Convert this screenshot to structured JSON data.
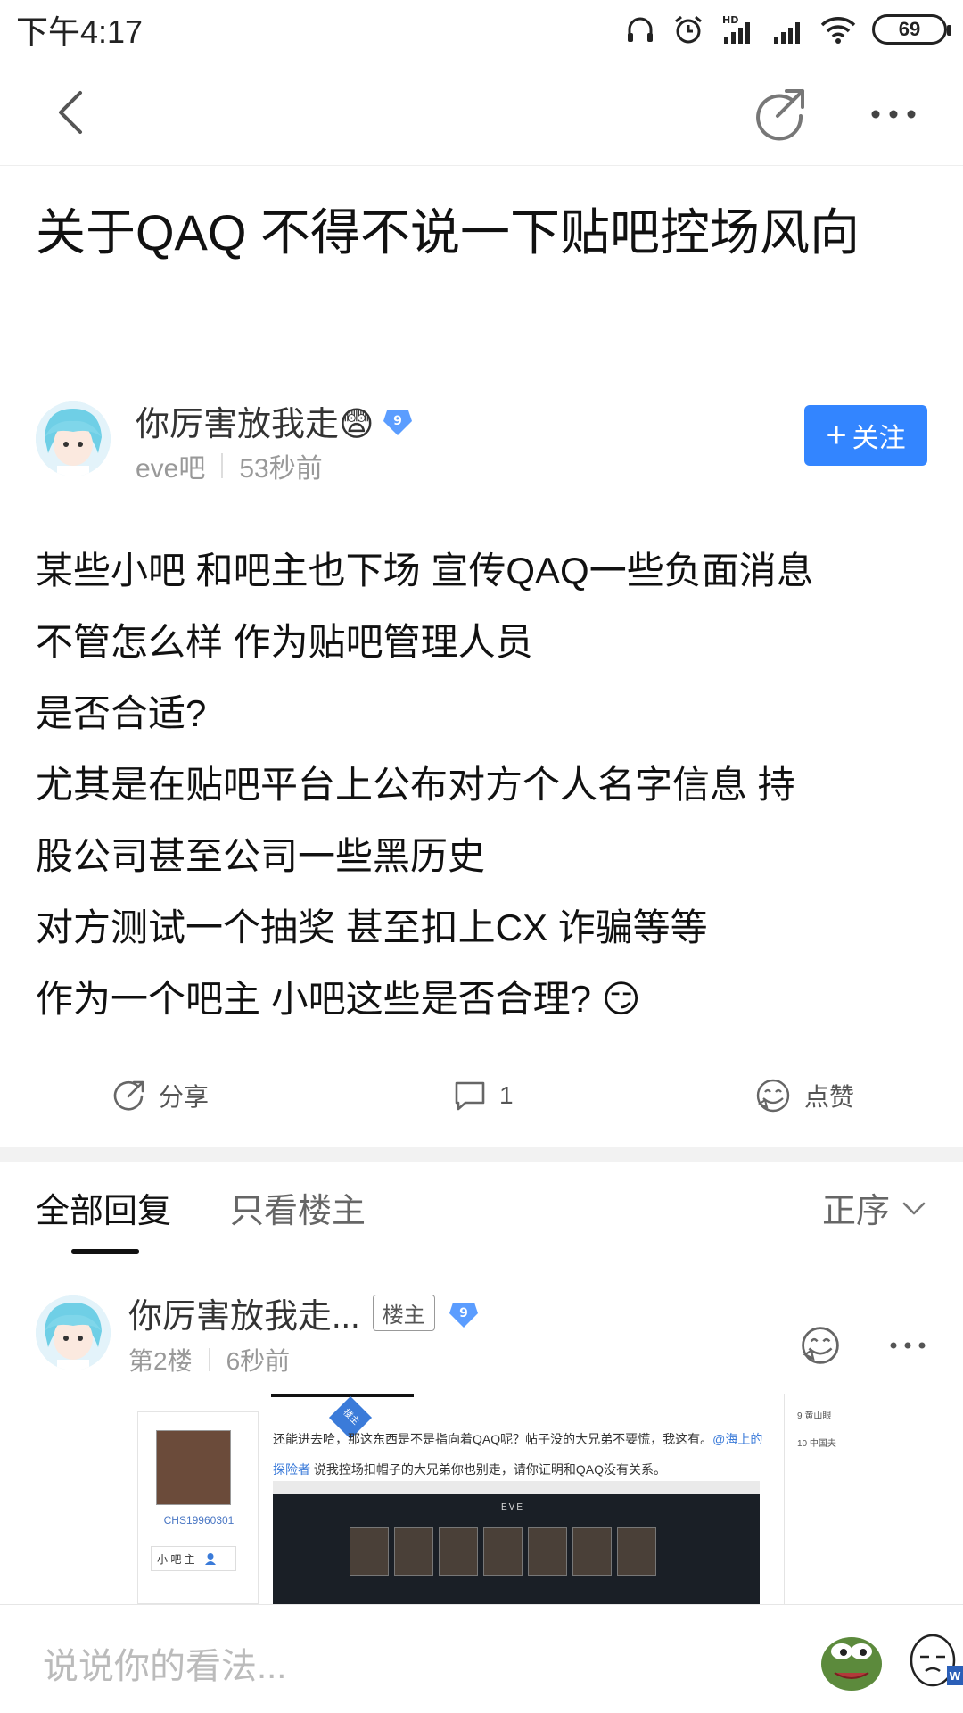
{
  "status_bar": {
    "time": "下午4:17",
    "battery": "69",
    "icons": [
      "headphones-icon",
      "alarm-icon",
      "hd-signal-icon",
      "signal-icon",
      "wifi-icon",
      "battery-icon"
    ]
  },
  "nav": {
    "back_icon": "chevron-left-icon",
    "share_icon": "share-icon",
    "more_icon": "more-icon"
  },
  "post": {
    "title": "关于QAQ 不得不说一下贴吧控场风向",
    "author": {
      "name": "你厉害放我走😨",
      "level": "9",
      "forum": "eve吧",
      "time": "53秒前"
    },
    "follow_label": "关注",
    "body_lines": [
      "某些小吧 和吧主也下场 宣传QAQ一些负面消息",
      "不管怎么样 作为贴吧管理人员",
      "是否合适?",
      "尤其是在贴吧平台上公布对方个人名字信息 持",
      "股公司甚至公司一些黑历史",
      "对方测试一个抽奖 甚至扣上CX 诈骗等等",
      "作为一个吧主 小吧这些是否合理? 😏"
    ],
    "actions": {
      "share_label": "分享",
      "comment_count": "1",
      "like_label": "点赞"
    }
  },
  "tabs": {
    "all_replies": "全部回复",
    "owner_only": "只看楼主",
    "sort_label": "正序"
  },
  "reply": {
    "name": "你厉害放我走...",
    "owner_tag": "楼主",
    "level": "9",
    "floor": "第2楼",
    "time": "6秒前",
    "image": {
      "ribbon": "楼主",
      "user_id": "CHS19960301",
      "role": "小 吧 主",
      "text_1": "还能进去哈，那这东西是不是指向着QAQ呢？帖子没的大兄弟不要慌，我这有。",
      "mention": "@海上的探险者",
      "text_2": "说我控场扣帽子的大兄弟你也别走，请你证明和QAQ没有关系。",
      "game_logo": "EVE",
      "side_1": "9   黄山眼",
      "side_2": "10  中国夫"
    }
  },
  "composer": {
    "placeholder": "说说你的看法..."
  },
  "colors": {
    "accent": "#3385ff",
    "text": "#111111",
    "muted": "#999999"
  }
}
